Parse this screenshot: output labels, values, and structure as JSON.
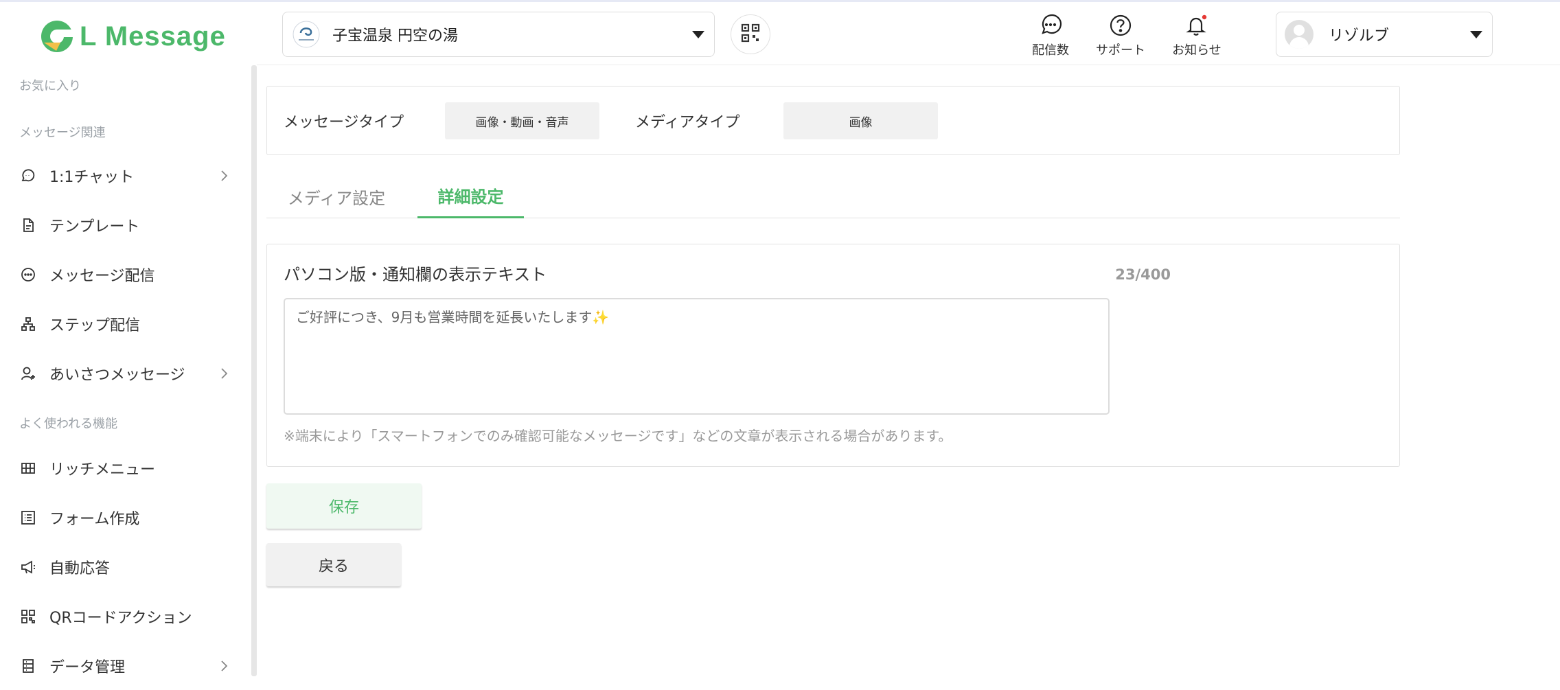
{
  "app": {
    "brand": "L Message",
    "brand_color": "#4cb86a"
  },
  "sidebar": {
    "sections": {
      "favorites": "お気に入り",
      "message": "メッセージ関連",
      "frequent": "よく使われる機能"
    },
    "items": [
      {
        "label": "1:1チャット",
        "icon": "chat-icon",
        "has_submenu": true
      },
      {
        "label": "テンプレート",
        "icon": "document-icon",
        "has_submenu": false
      },
      {
        "label": "メッセージ配信",
        "icon": "message-broadcast-icon",
        "has_submenu": false
      },
      {
        "label": "ステップ配信",
        "icon": "step-hierarchy-icon",
        "has_submenu": false
      },
      {
        "label": "あいさつメッセージ",
        "icon": "user-add-icon",
        "has_submenu": true
      },
      {
        "label": "リッチメニュー",
        "icon": "grid-menu-icon",
        "has_submenu": false
      },
      {
        "label": "フォーム作成",
        "icon": "form-list-icon",
        "has_submenu": false
      },
      {
        "label": "自動応答",
        "icon": "megaphone-icon",
        "has_submenu": false
      },
      {
        "label": "QRコードアクション",
        "icon": "qr-code-icon",
        "has_submenu": false
      },
      {
        "label": "データ管理",
        "icon": "database-icon",
        "has_submenu": true
      }
    ]
  },
  "header": {
    "account_name": "子宝温泉 円空の湯",
    "buttons": {
      "broadcast_count": "配信数",
      "support": "サポート",
      "notifications": "お知らせ"
    },
    "user_name": "リゾルブ",
    "notification_dot_color": "#e53935"
  },
  "message_type": {
    "type_label": "メッセージタイプ",
    "type_value": "画像・動画・音声",
    "media_label": "メディアタイプ",
    "media_value": "画像"
  },
  "tabs": [
    {
      "label": "メディア設定",
      "active": false
    },
    {
      "label": "詳細設定",
      "active": true
    }
  ],
  "detail": {
    "field_title": "パソコン版・通知欄の表示テキスト",
    "counter": "23/400",
    "text_value": "ご好評につき、9月も営業時間を延長いたします✨",
    "note": "※端末により「スマートフォンでのみ確認可能なメッセージです」などの文章が表示される場合があります。"
  },
  "actions": {
    "save": "保存",
    "back": "戻る"
  }
}
